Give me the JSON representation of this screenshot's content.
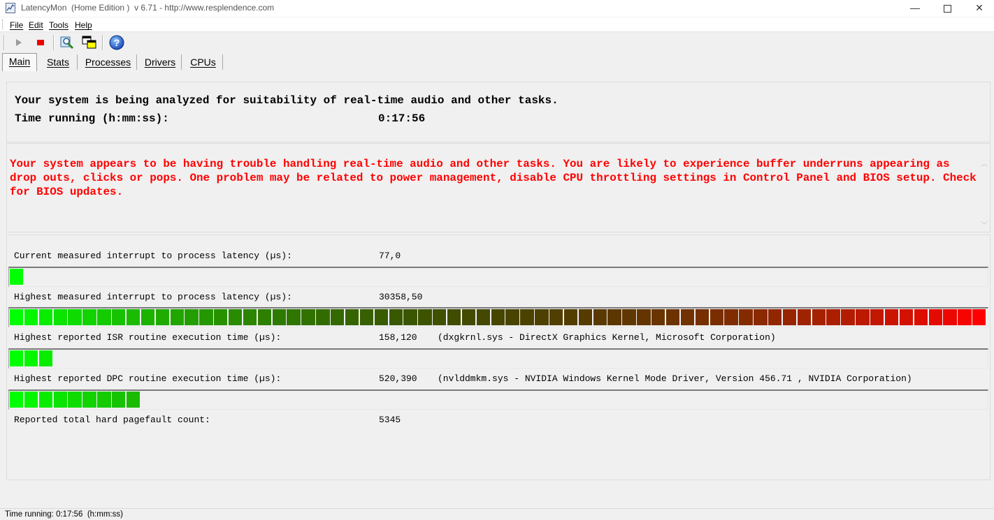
{
  "window": {
    "title": "LatencyMon  (Home Edition )  v 6.71 - http://www.resplendence.com",
    "min_glyph": "—",
    "close_glyph": "✕"
  },
  "menu": [
    "File",
    "Edit",
    "Tools",
    "Help"
  ],
  "toolbar": {
    "icons": [
      "play-icon",
      "stop-icon",
      "analyze-icon",
      "windows-icon",
      "help-icon"
    ],
    "help_glyph": "?"
  },
  "tabs": [
    "Main",
    "Stats",
    "Processes",
    "Drivers",
    "CPUs"
  ],
  "active_tab": "Main",
  "analysis": {
    "line1": "Your system is being analyzed for suitability of real-time audio and other tasks.",
    "time_label": "Time running (h:mm:ss):",
    "time_value": "0:17:56"
  },
  "warning": {
    "text": "Your system appears to be having trouble handling real-time audio and other tasks. You are likely to experience buffer underruns appearing as drop outs, clicks or pops. One problem may be related to power management, disable CPU throttling settings in Control Panel and BIOS setup. Check for BIOS updates.",
    "color": "#ff0000"
  },
  "metrics": {
    "current_latency": {
      "label": "Current measured interrupt to process latency (µs):",
      "value": "77,0",
      "bar_segments": 1
    },
    "highest_latency": {
      "label": "Highest measured interrupt to process latency (µs):",
      "value": "30358,50",
      "bar_segments": 67
    },
    "isr": {
      "label": "Highest reported ISR routine execution time (µs):",
      "value": "158,120",
      "detail": "(dxgkrnl.sys - DirectX Graphics Kernel, Microsoft Corporation)",
      "bar_segments": 3
    },
    "dpc": {
      "label": "Highest reported DPC routine execution time (µs):",
      "value": "520,390",
      "detail": "(nvlddmkm.sys - NVIDIA Windows Kernel Mode Driver, Version 456.71 , NVIDIA Corporation)",
      "bar_segments": 9
    },
    "pagefault": {
      "label": "Reported total hard pagefault count:",
      "value": "5345"
    }
  },
  "bar_colors": {
    "start": "#00ff00",
    "end": "#ff0000",
    "total_segments": 67
  },
  "statusbar": {
    "text": "Time running: 0:17:56  (h:mm:ss)"
  }
}
